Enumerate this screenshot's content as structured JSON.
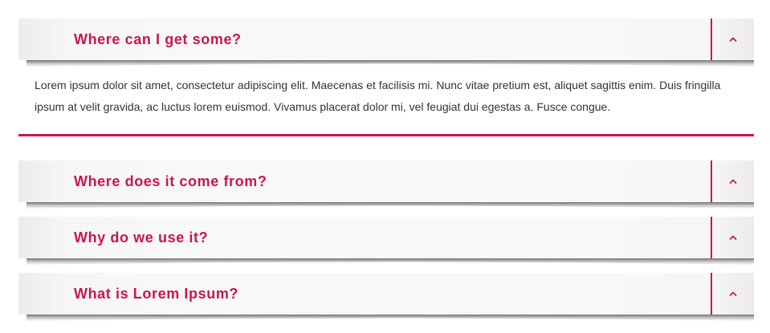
{
  "colors": {
    "accent": "#c9164e",
    "header_bg": "#f8f8f8",
    "text": "#333333"
  },
  "faq": {
    "items": [
      {
        "title": "Where can I get some?",
        "expanded": true,
        "icon": "chevron-up-icon",
        "body": "Lorem ipsum dolor sit amet, consectetur adipiscing elit. Maecenas et facilisis mi. Nunc vitae pretium est, aliquet sagittis enim. Duis fringilla ipsum at velit gravida, ac luctus lorem euismod. Vivamus placerat dolor mi, vel feugiat dui egestas a. Fusce congue."
      },
      {
        "title": "Where does it come from?",
        "expanded": false,
        "icon": "chevron-up-icon"
      },
      {
        "title": "Why do we use it?",
        "expanded": false,
        "icon": "chevron-up-icon"
      },
      {
        "title": "What is Lorem Ipsum?",
        "expanded": false,
        "icon": "chevron-up-icon"
      }
    ]
  }
}
